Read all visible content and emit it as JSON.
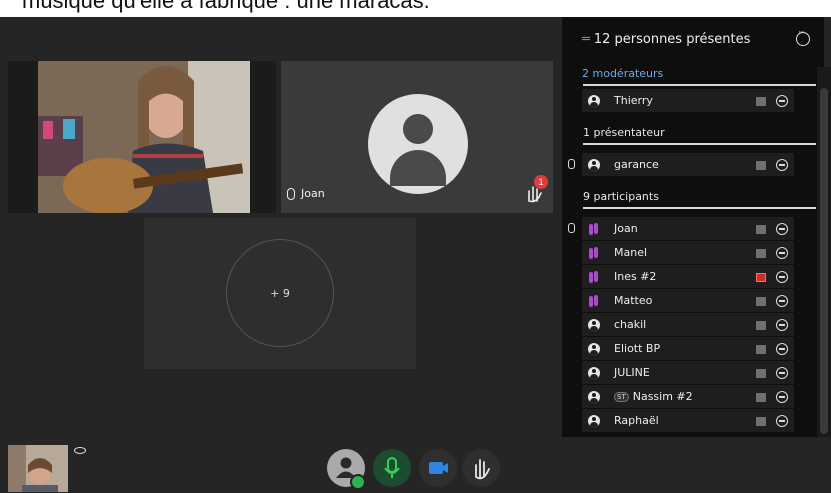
{
  "caption": "musique qu'elle a fabriqué : une maracas.",
  "tiles": {
    "joan_name": "Joan",
    "raise_hand_count": "1",
    "more_label": "+ 9"
  },
  "panel": {
    "title": "12 personnes présentes",
    "moderators_title": "2 modérateurs",
    "presenter_title": "1 présentateur",
    "participants_title": "9 participants",
    "moderators": [
      {
        "name": "Thierry"
      }
    ],
    "presenters": [
      {
        "name": "garance"
      }
    ],
    "participants": [
      {
        "name": "Joan"
      },
      {
        "name": "Manel"
      },
      {
        "name": "Ines #2"
      },
      {
        "name": "Matteo"
      },
      {
        "name": "chakil"
      },
      {
        "name": "Eliott BP"
      },
      {
        "name": "JULINE"
      },
      {
        "name": "Nassim #2",
        "badge": "ST"
      },
      {
        "name": "Raphaël"
      }
    ]
  },
  "colors": {
    "accent_blue": "#6fa8e6",
    "raised_hand": "#a84ccc",
    "mic_active": "#1c4d2f",
    "camera_active": "#2e86de",
    "status_ok": "#2cb24f",
    "alert_red": "#e23a3a"
  }
}
